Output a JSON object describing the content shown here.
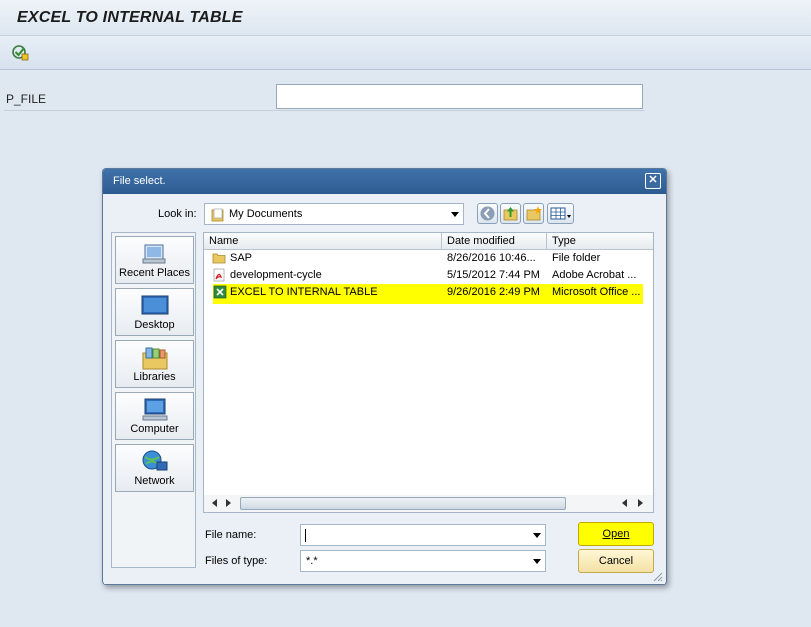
{
  "app": {
    "title": "EXCEL TO INTERNAL TABLE"
  },
  "toolbar": {
    "execute_icon": "execute-icon"
  },
  "selection": {
    "param_label": "P_FILE",
    "param_value": ""
  },
  "dialog": {
    "title": "File select.",
    "close_icon": "close-icon",
    "look_in_label": "Look in:",
    "look_in_value": "My Documents",
    "places": [
      {
        "label": "Recent Places",
        "icon": "recent-places-icon"
      },
      {
        "label": "Desktop",
        "icon": "desktop-icon"
      },
      {
        "label": "Libraries",
        "icon": "libraries-icon"
      },
      {
        "label": "Computer",
        "icon": "computer-icon"
      },
      {
        "label": "Network",
        "icon": "network-icon"
      }
    ],
    "columns": {
      "name": "Name",
      "date_modified": "Date modified",
      "type": "Type"
    },
    "files": [
      {
        "name": "SAP",
        "date": "8/26/2016 10:46...",
        "type": "File folder",
        "icon": "folder-icon"
      },
      {
        "name": "development-cycle",
        "date": "5/15/2012 7:44 PM",
        "type": "Adobe Acrobat ...",
        "icon": "pdf-icon"
      },
      {
        "name": "EXCEL TO INTERNAL TABLE",
        "date": "9/26/2016 2:49 PM",
        "type": "Microsoft Office ...",
        "icon": "excel-icon",
        "selected": true
      }
    ],
    "file_name_label": "File name:",
    "file_name_value": "",
    "file_type_label": "Files of type:",
    "file_type_value": "*.*",
    "open_label": "Open",
    "cancel_label": "Cancel",
    "colors": {
      "selection": "#ffff00",
      "header": "#2c5b91"
    }
  }
}
